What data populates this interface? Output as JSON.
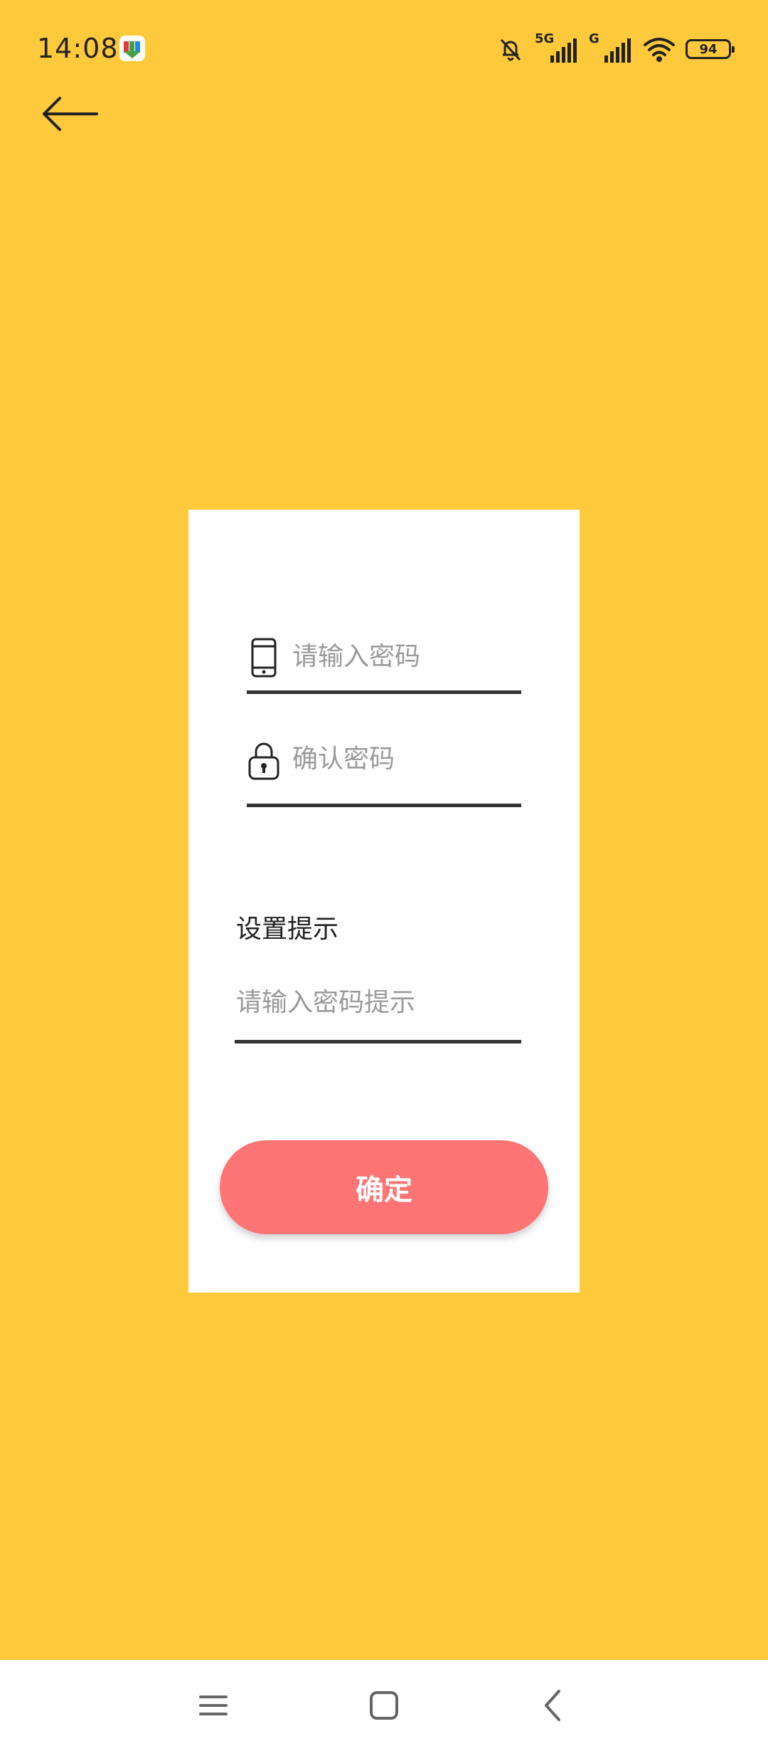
{
  "status_bar": {
    "time": "14:08",
    "network_1": "5G",
    "network_2": "G",
    "battery": "94",
    "icons": [
      "app-notification-icon",
      "bell-off-icon",
      "signal-icon",
      "wifi-icon",
      "battery-icon"
    ]
  },
  "header": {
    "back_icon": "arrow-left-icon"
  },
  "form": {
    "password_placeholder": "请输入密码",
    "confirm_placeholder": "确认密码",
    "hint_label": "设置提示",
    "hint_placeholder": "请输入密码提示",
    "confirm_button": "确定",
    "field_icons": [
      "phone-icon",
      "lock-icon"
    ]
  },
  "nav": {
    "icons": [
      "menu-icon",
      "home-icon",
      "back-icon"
    ]
  },
  "colors": {
    "background": "#FFC93C",
    "card": "#FFFFFF",
    "button": "#FF7474",
    "underline": "#333333",
    "placeholder": "#9A9A9A"
  }
}
